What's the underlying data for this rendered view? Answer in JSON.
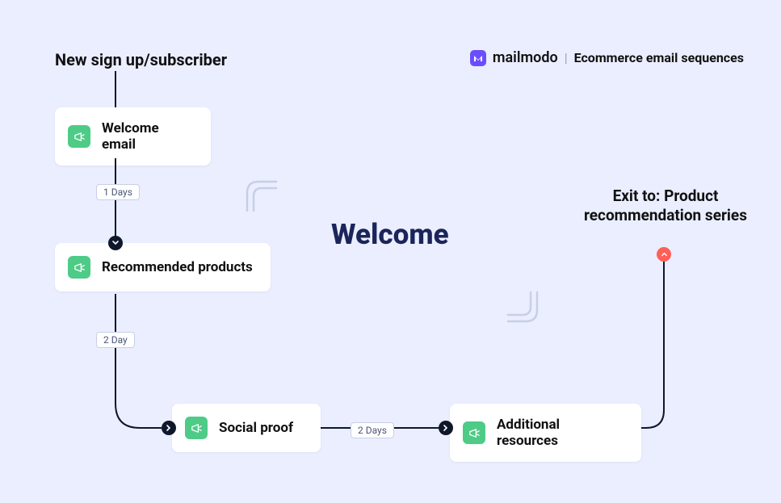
{
  "brand": {
    "name": "mailmodo",
    "separator": "|",
    "subtitle": "Ecommerce email sequences"
  },
  "trigger_label": "New sign up/subscriber",
  "title": "Welcome",
  "exit_label": "Exit to: Product recommendation series",
  "nodes": {
    "welcome_email": "Welcome email",
    "recommended_products": "Recommended products",
    "social_proof": "Social proof",
    "additional_resources": "Additional resources"
  },
  "delays": {
    "d1": "1 Days",
    "d2": "2 Day",
    "d3": "2 Days"
  },
  "colors": {
    "background": "#ebeeff",
    "node_icon": "#4ecb87",
    "title": "#1b2559",
    "brand": "#6b4dff",
    "exit_dot": "#ff5f57"
  }
}
